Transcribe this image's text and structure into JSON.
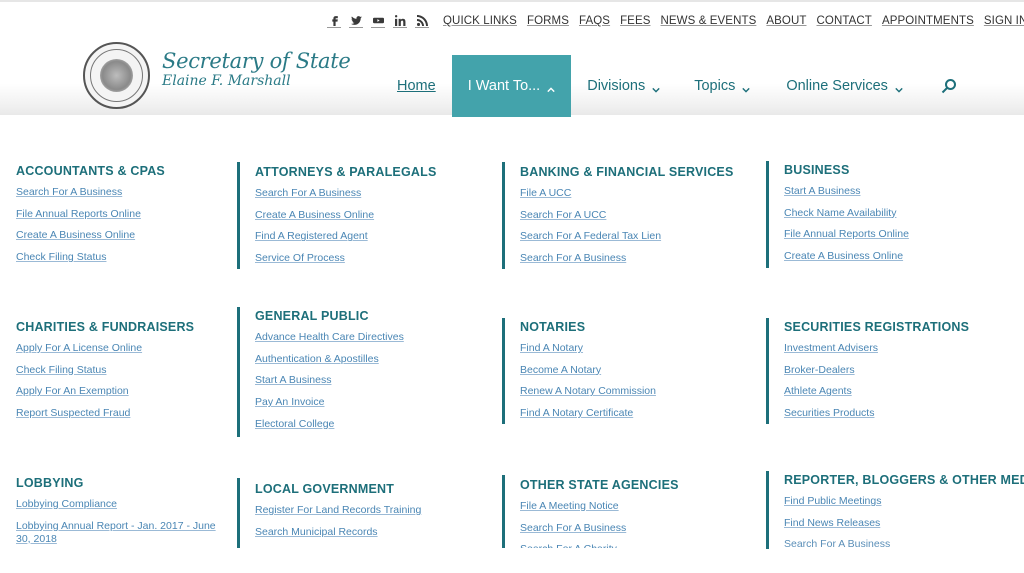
{
  "utility_bar": {
    "social_icons": [
      {
        "name": "facebook-icon",
        "glyph": "f"
      },
      {
        "name": "twitter-icon",
        "glyph": "t"
      },
      {
        "name": "youtube-icon",
        "glyph": "y"
      },
      {
        "name": "linkedin-icon",
        "glyph": "in"
      },
      {
        "name": "rss-icon",
        "glyph": "rss"
      }
    ],
    "links": [
      "QUICK LINKS",
      "FORMS",
      "FAQS",
      "FEES",
      "NEWS & EVENTS",
      "ABOUT",
      "CONTACT",
      "APPOINTMENTS",
      "SIGN IN"
    ]
  },
  "logo": {
    "title": "Secretary of State",
    "subtitle": "Elaine F. Marshall"
  },
  "main_nav": {
    "home": "Home",
    "i_want_to": "I Want To...",
    "divisions": "Divisions",
    "topics": "Topics",
    "online_services": "Online Services"
  },
  "colors": {
    "accent": "#43a3ab",
    "heading": "#1d6f7a",
    "link": "#4a86b4"
  },
  "mega_menu": {
    "groups": [
      {
        "title": "ACCOUNTANTS & CPAS",
        "links": [
          "Search For A Business",
          "File Annual Reports Online",
          "Create A Business Online",
          "Check Filing Status"
        ]
      },
      {
        "title": "ATTORNEYS & PARALEGALS",
        "links": [
          "Search For A Business",
          "Create A Business Online",
          "Find A Registered Agent",
          "Service Of Process"
        ]
      },
      {
        "title": "BANKING & FINANCIAL SERVICES",
        "links": [
          "File A UCC",
          "Search For A UCC",
          "Search For A Federal Tax Lien",
          "Search For A Business"
        ]
      },
      {
        "title": "BUSINESS",
        "links": [
          "Start A Business",
          "Check Name Availability",
          "File Annual Reports Online",
          "Create A Business Online"
        ]
      },
      {
        "title": "CHARITIES & FUNDRAISERS",
        "links": [
          "Apply For A License Online",
          "Check Filing Status",
          "Apply For An Exemption",
          "Report Suspected Fraud"
        ]
      },
      {
        "title": "GENERAL PUBLIC",
        "links": [
          "Advance Health Care Directives",
          "Authentication & Apostilles",
          "Start A Business",
          "Pay An Invoice",
          "Electoral College"
        ]
      },
      {
        "title": "NOTARIES",
        "links": [
          "Find A Notary",
          "Become A Notary",
          "Renew A Notary Commission",
          "Find A Notary Certificate"
        ]
      },
      {
        "title": "SECURITIES REGISTRATIONS",
        "links": [
          "Investment Advisers",
          "Broker-Dealers",
          "Athlete Agents",
          "Securities Products"
        ]
      },
      {
        "title": "LOBBYING",
        "links": [
          "Lobbying Compliance",
          "Lobbying Annual Report - Jan. 2017 - June 30, 2018"
        ]
      },
      {
        "title": "LOCAL GOVERNMENT",
        "links": [
          "Register For Land Records Training",
          "Search Municipal Records"
        ]
      },
      {
        "title": "OTHER STATE AGENCIES",
        "links": [
          "File A Meeting Notice",
          "Search For A Business",
          "Search For A Charity"
        ]
      },
      {
        "title": "REPORTER, BLOGGERS & OTHER MEDIA",
        "links": [
          "Find Public Meetings",
          "Find News Releases",
          "Search For A Business"
        ]
      }
    ]
  }
}
